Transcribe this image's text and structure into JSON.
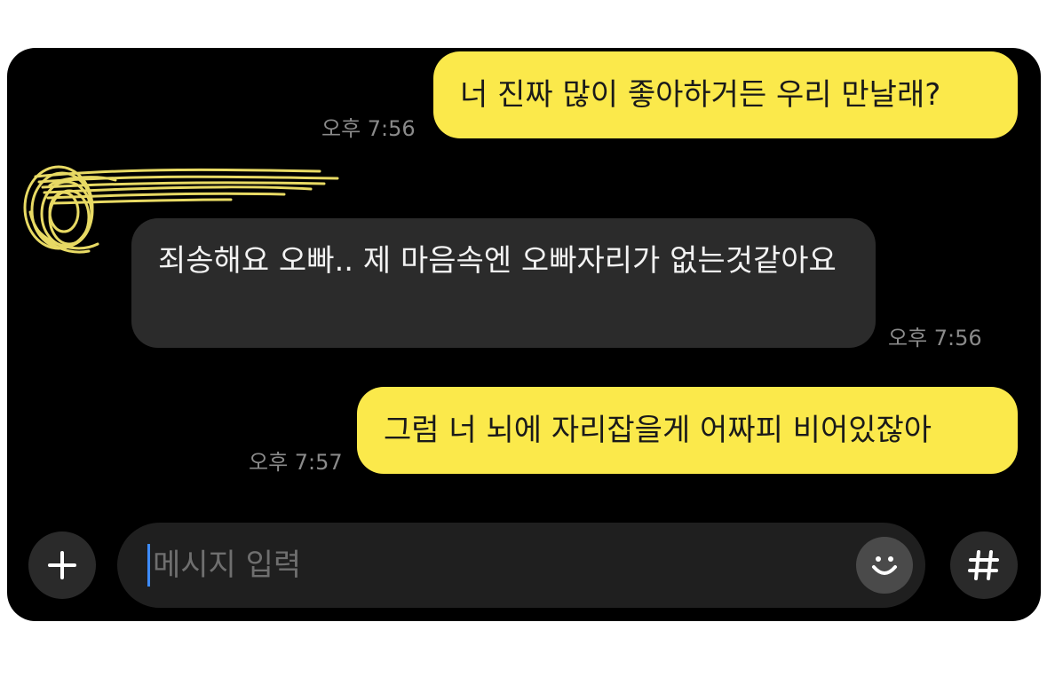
{
  "messages": [
    {
      "sender": "me",
      "text": "너 진짜 많이 좋아하거든 우리 만날래?",
      "time": "오후 7:56"
    },
    {
      "sender": "them",
      "text": "죄송해요 오빠.. 제 마음속엔 오빠자리가 없는것같아요",
      "time": "오후 7:56"
    },
    {
      "sender": "me",
      "text": "그럼 너 뇌에 자리잡을게 어짜피 비어있잖아",
      "time": "오후 7:57"
    }
  ],
  "input": {
    "placeholder": "메시지 입력",
    "add_icon": "plus-icon",
    "emoji_icon": "smiley-icon",
    "hashtag_icon": "hashtag-icon"
  },
  "colors": {
    "background": "#000000",
    "my_bubble": "#fbe94b",
    "their_bubble": "#2b2b2b",
    "timestamp": "#8a8a8a",
    "scribble": "#f5e66a"
  }
}
